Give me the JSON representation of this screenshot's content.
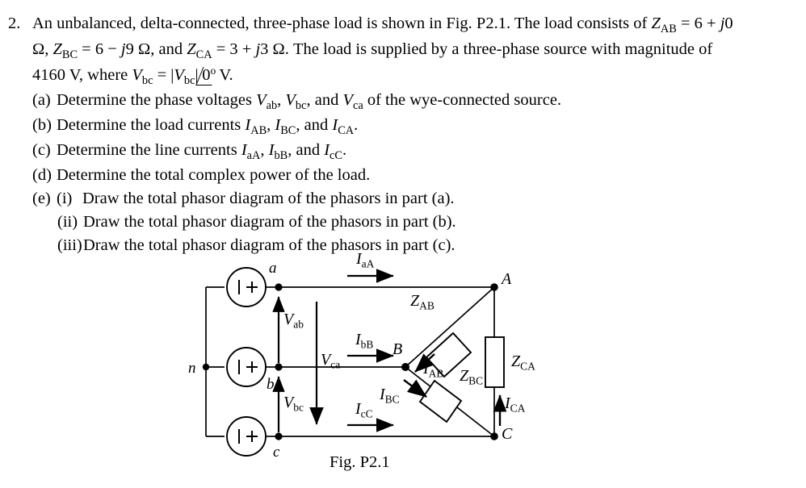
{
  "problem": {
    "number": "2.",
    "line1_a": "An unbalanced, delta-connected, three-phase load is shown in Fig. P2.1. The load consists of ",
    "line1_z": "Z",
    "line1_zsub": "AB",
    "line1_b": " = 6 + ",
    "line1_j": "j",
    "line1_c": "0",
    "line2_ohm": "Ω, ",
    "line2_z1": "Z",
    "line2_z1sub": "BC",
    "line2_eq1": " = 6 − ",
    "line2_j1": "j",
    "line2_v1": "9 Ω, and ",
    "line2_z2": "Z",
    "line2_z2sub": "CA",
    "line2_eq2": " = 3 + ",
    "line2_j2": "j",
    "line2_v2": "3 Ω. The load is supplied by a three-phase source with magnitude of",
    "line3_a": "4160 V, where ",
    "line3_v1": "V",
    "line3_v1sub": "bc",
    "line3_eq": " = |",
    "line3_v2": "V",
    "line3_v2sub": "bc",
    "line3_bar": "|",
    "line3_angle": "0",
    "line3_deg": "o",
    "line3_end": " V."
  },
  "parts": {
    "a": {
      "tag": "(a)",
      "text1": "Determine the phase voltages ",
      "v1": "V",
      "v1sub": "ab",
      "sep1": ", ",
      "v2": "V",
      "v2sub": "bc",
      "sep2": ", and ",
      "v3": "V",
      "v3sub": "ca",
      "text2": " of the wye-connected source."
    },
    "b": {
      "tag": "(b)",
      "text1": "Determine the load currents ",
      "i1": "I",
      "i1sub": "AB",
      "sep1": ", ",
      "i2": "I",
      "i2sub": "BC",
      "sep2": ", and ",
      "i3": "I",
      "i3sub": "CA",
      "text2": "."
    },
    "c": {
      "tag": "(c)",
      "text1": "Determine the line currents ",
      "i1": "I",
      "i1sub": "aA",
      "sep1": ", ",
      "i2": "I",
      "i2sub": "bB",
      "sep2": ", and ",
      "i3": "I",
      "i3sub": "cC",
      "text2": "."
    },
    "d": {
      "tag": "(d)",
      "text": "Determine the total complex power of the load."
    },
    "e": {
      "tag": "(e)",
      "items": [
        {
          "tag": "(i)",
          "text": "Draw the total phasor diagram of the phasors in part (a)."
        },
        {
          "tag": "(ii)",
          "text": "Draw the total phasor diagram of the phasors in part (b)."
        },
        {
          "tag": "(iii)",
          "text": "Draw the total phasor diagram of the phasors in part (c)."
        }
      ]
    }
  },
  "figure": {
    "caption": "Fig. P2.1",
    "nodes": {
      "n": "n",
      "a": "a",
      "b": "b",
      "c": "c",
      "A": "A",
      "B": "B",
      "C": "C"
    },
    "voltages": {
      "vab": "V",
      "vab_sub": "ab",
      "vca": "V",
      "vca_sub": "ca",
      "vbc": "V",
      "vbc_sub": "bc"
    },
    "line_currents": {
      "iaA": "I",
      "iaA_sub": "aA",
      "ibB": "I",
      "ibB_sub": "bB",
      "icC": "I",
      "icC_sub": "cC"
    },
    "load_currents": {
      "iAB": "I",
      "iAB_sub": "AB",
      "iBC": "I",
      "iBC_sub": "BC",
      "iCA": "I",
      "iCA_sub": "CA"
    },
    "impedances": {
      "zAB": "Z",
      "zAB_sub": "AB",
      "zBC": "Z",
      "zBC_sub": "BC",
      "zCA": "Z",
      "zCA_sub": "CA"
    },
    "source_symbol": "|+"
  },
  "colors": {
    "ink": "#000000",
    "background": "#ffffff"
  }
}
